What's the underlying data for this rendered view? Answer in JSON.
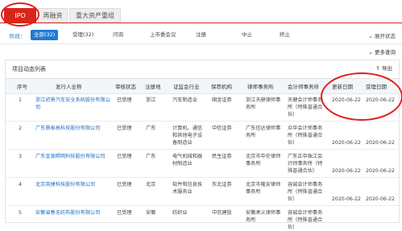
{
  "tabs": [
    {
      "label": "IPO",
      "active": true
    },
    {
      "label": "再融资",
      "active": false
    },
    {
      "label": "重大资产重组",
      "active": false
    }
  ],
  "filter": {
    "stage_label": "阶段：",
    "options": [
      "全部(32)",
      "受理(32)",
      "问询",
      "上市委会议",
      "注册",
      "中止",
      "终止"
    ],
    "selected_index": 0,
    "expand_label": "展开状态",
    "expand_icon": "chevron-down-icon",
    "more_label": "更多查询",
    "more_icon": "chevron-down-icon"
  },
  "panel": {
    "title": "项目动态列表",
    "export_label": "导出",
    "export_icon": "export-icon"
  },
  "table": {
    "headers": [
      "序号",
      "发行人全称",
      "审核状态",
      "注册地",
      "证监会行业",
      "保荐机构",
      "律师事务所",
      "会计师事务所",
      "更新日期",
      "受理日期"
    ],
    "rows": [
      {
        "no": "1",
        "name": "浙江初景汽车安全系统股份有限公司",
        "status": "已受理",
        "place": "浙江",
        "industry": "汽车制造业",
        "sponsor": "国金证券",
        "law": "浙江天册律师事务所",
        "account": "天健会计师事务所（特殊普通合伙）",
        "updated": "2020-06-22",
        "accepted": "2020-06-22"
      },
      {
        "no": "2",
        "name": "广东鼎泰高科技股份有限公司",
        "status": "已受理",
        "place": "广东",
        "industry": "计算机、通信和其他电子设备制造业",
        "sponsor": "中信证券",
        "law": "广东信达律师事务所",
        "account": "众华会计师事务所（特殊普通合伙）",
        "updated": "2020-06-22",
        "accepted": "2020-06-22"
      },
      {
        "no": "3",
        "name": "广东金源照明科技股份有限公司",
        "status": "已受理",
        "place": "广东",
        "industry": "电气机械和器材制造业",
        "sponsor": "民生证券",
        "law": "北京市中伦律师事务所",
        "account": "广东正中珠江会计师事务所（特殊普通合伙）",
        "updated": "2020-06-22",
        "accepted": "2020-06-22"
      },
      {
        "no": "4",
        "name": "北京英捷科技股份有限公司",
        "status": "已受理",
        "place": "北京",
        "industry": "软件和信息技术服务业",
        "sponsor": "东北证券",
        "law": "北京市隆安律师事务所",
        "account": "容诚会计师事务所（特殊普通合伙）",
        "updated": "2020-06-22",
        "accepted": "2020-06-22"
      },
      {
        "no": "5",
        "name": "安徽省春无纺布股份有限公司",
        "status": "已受理",
        "place": "安徽",
        "industry": "纺织业",
        "sponsor": "中信建投",
        "law": "安徽承义律师事务所",
        "account": "容诚会计师事务所（特殊普通合伙）",
        "updated": "",
        "accepted": ""
      }
    ]
  },
  "colors": {
    "accent_red": "#d9261c",
    "link_blue": "#1f6fc5",
    "chip_blue": "#1f7bd1",
    "annotation_red": "#e02020"
  }
}
